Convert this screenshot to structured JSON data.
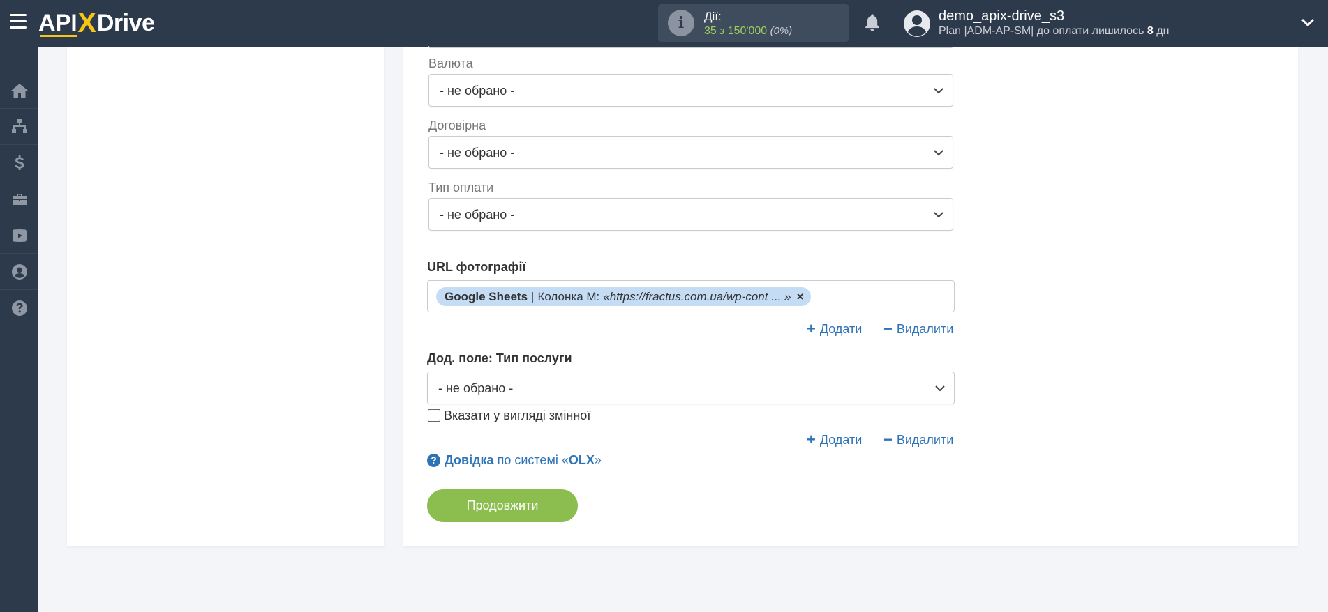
{
  "header": {
    "logo": {
      "part1": "API",
      "part2": "X",
      "part3": "Drive"
    },
    "actions": {
      "label": "Дії:",
      "count": "35",
      "of": "з",
      "limit": "150'000",
      "percent": "(0%)"
    },
    "user": {
      "name": "demo_apix-drive_s3",
      "plan_prefix": "Plan |ADM-AP-SM| до оплати лишилось",
      "days": "8",
      "days_suffix": "дн"
    }
  },
  "sidebar": {
    "items": [
      {
        "icon": "home-icon"
      },
      {
        "icon": "sitemap-icon"
      },
      {
        "icon": "dollar-icon"
      },
      {
        "icon": "briefcase-icon"
      },
      {
        "icon": "youtube-icon"
      },
      {
        "icon": "user-circle-icon"
      },
      {
        "icon": "question-circle-icon"
      }
    ]
  },
  "form": {
    "currency": {
      "label": "Валюта",
      "value": "- не обрано -"
    },
    "negotiable": {
      "label": "Договірна",
      "value": "- не обрано -"
    },
    "payment_type": {
      "label": "Тип оплати",
      "value": "- не обрано -"
    },
    "photo_url": {
      "label": "URL фотографії",
      "tag_source": "Google Sheets",
      "tag_sep": "|",
      "tag_column": "Колонка M:",
      "tag_value": "«https://fractus.com.ua/wp-cont ... »",
      "tag_remove": "×"
    },
    "add_label": "Додати",
    "remove_label": "Видалити",
    "service_type": {
      "label": "Дод. поле: Тип послуги",
      "value": "- не обрано -"
    },
    "as_variable_label": "Вказати у вигляді змінної",
    "help": {
      "bold": "Довідка",
      "text1": "по системі «",
      "system": "OLX",
      "text2": "»"
    },
    "continue_label": "Продовжити"
  },
  "colors": {
    "header_bg": "#2d3a4b",
    "accent_green": "#8bbd4f",
    "link_blue": "#2f73b7",
    "tag_bg": "#c5dcf5"
  }
}
